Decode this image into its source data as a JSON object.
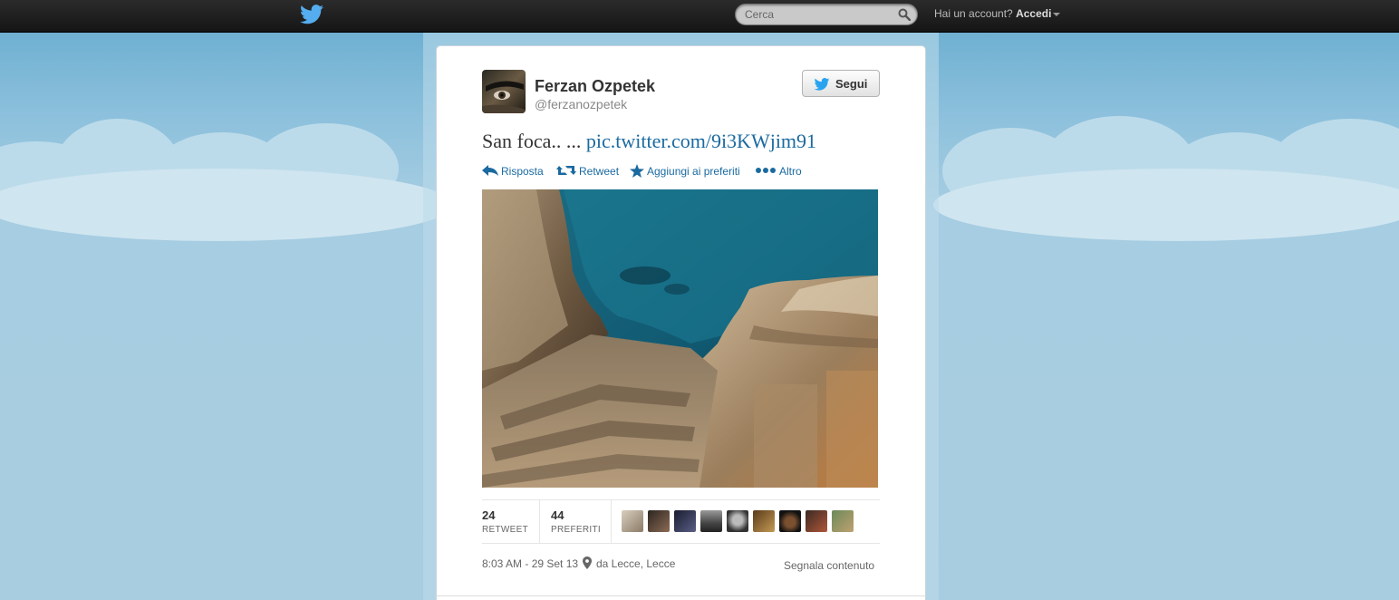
{
  "topbar": {
    "search": {
      "placeholder": "Cerca"
    },
    "login_prompt": "Hai un account?",
    "login_label": "Accedi"
  },
  "tweet": {
    "author": {
      "name": "Ferzan Ozpetek",
      "handle": "@ferzanozpetek"
    },
    "follow_label": "Segui",
    "text": "San foca..  ...",
    "link": "pic.twitter.com/9i3KWjim91",
    "actions": {
      "reply": "Risposta",
      "retweet": "Retweet",
      "favorite": "Aggiungi ai preferiti",
      "more": "Altro"
    },
    "stats": {
      "retweets": {
        "count": "24",
        "label": "RETWEET"
      },
      "favorites": {
        "count": "44",
        "label": "PREFERITI"
      }
    },
    "timestamp": "8:03 AM - 29 Set 13",
    "location": "da Lecce, Lecce",
    "report_label": "Segnala contenuto"
  },
  "colors": {
    "link": "#1a6aa0",
    "twitter_blue": "#55acee",
    "topbar": "#1f1f1f",
    "background": "#a9cde0"
  },
  "icons": [
    "twitter-bird-icon",
    "search-icon",
    "caret-down-icon",
    "reply-icon",
    "retweet-icon",
    "star-icon",
    "more-dots-icon",
    "location-pin-icon"
  ]
}
